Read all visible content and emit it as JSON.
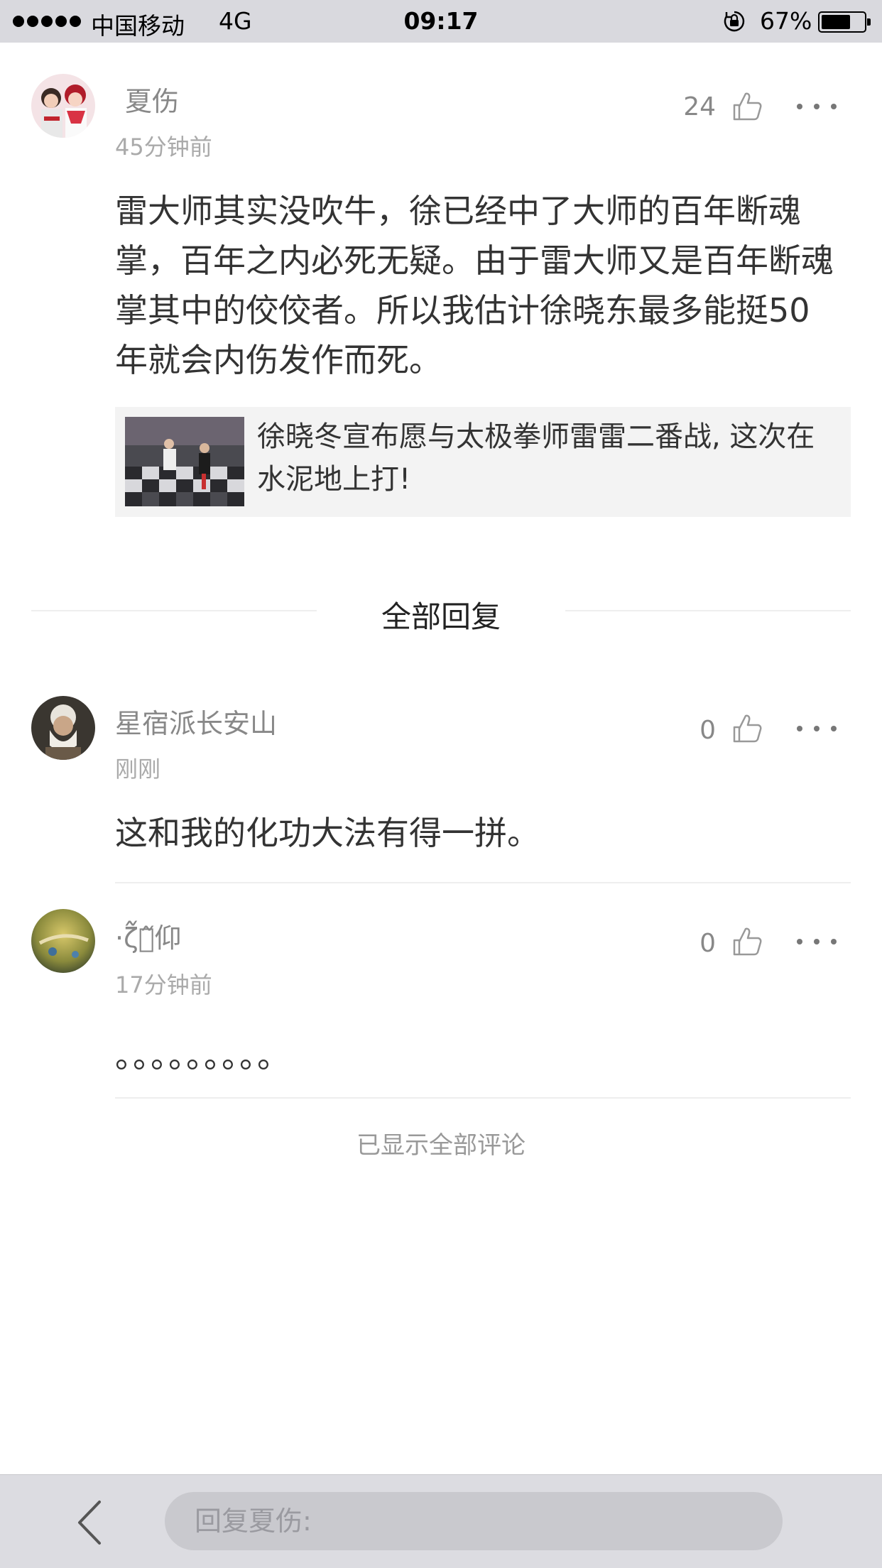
{
  "status_bar": {
    "carrier": "中国移动",
    "network": "4G",
    "time": "09:17",
    "battery": "67%",
    "battery_level": 0.67,
    "icons": [
      "signal-dots-icon",
      "orientation-lock-icon",
      "battery-icon"
    ]
  },
  "main_comment": {
    "username": "夏伤",
    "time": "45分钟前",
    "likes": "24",
    "content": "雷大师其实没吹牛，徐已经中了大师的百年断魂掌，百年之内必死无疑。由于雷大师又是百年断魂掌其中的佼佼者。所以我估计徐晓东最多能挺50年就会内伤发作而死。",
    "article": {
      "title": "徐晓冬宣布愿与太极拳师雷雷二番战, 这次在水泥地上打!"
    }
  },
  "replies_header": "全部回复",
  "replies": [
    {
      "username": "星宿派长安山",
      "time": "刚刚",
      "likes": "0",
      "content": "这和我的化功大法有得一拼。"
    },
    {
      "username": "·ζ᷉信᷉仰",
      "time": "17分钟前",
      "likes": "0",
      "content": "。。。。。。。。。"
    }
  ],
  "end_note": "已显示全部评论",
  "bottom_bar": {
    "reply_placeholder": "回复夏伤:"
  },
  "colors": {
    "status_bar_bg": "#d9d9de",
    "bottom_bar_bg": "#dcdce1",
    "article_bg": "#f3f3f3",
    "muted_text": "#888888"
  }
}
